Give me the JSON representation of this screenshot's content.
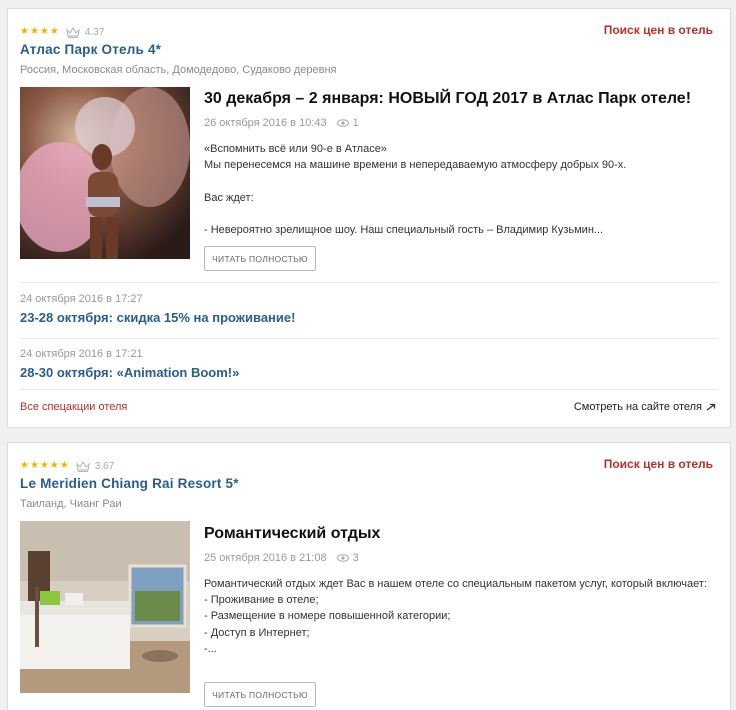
{
  "hotels": [
    {
      "stars": 4,
      "rating": "4.37",
      "price_link": "Поиск цен в отель",
      "name": "Атлас Парк Отель 4*",
      "location": "Россия, Московская область, Домодедово, Судаково деревня",
      "post": {
        "title": "30 декабря – 2 января: НОВЫЙ ГОД 2017 в Атлас Парк отеле!",
        "date": "26 октября 2016 в 10:43",
        "views": "1",
        "text": "«Вспомнить всё или 90-е в Атласе»\nМы перенесемся на машине времени в непередаваемую атмосферу добрых 90-х.\n\nВас ждет:\n\n- Невероятно зрелищное шоу. Наш специальный гость – Владимир Кузьмин...",
        "read_more": "ЧИТАТЬ ПОЛНОСТЬЮ"
      },
      "more_posts": [
        {
          "date": "24 октября 2016 в 17:27",
          "title": "23-28 октября: скидка 15% на проживание!"
        },
        {
          "date": "24 октября 2016 в 17:21",
          "title": "28-30 октября: «Animation Boom!»"
        }
      ],
      "all_offers": "Все спецакции отеля",
      "site_link": "Смотреть на сайте отеля"
    },
    {
      "stars": 5,
      "rating": "3.67",
      "price_link": "Поиск цен в отель",
      "name": "Le Meridien Chiang Rai Resort 5*",
      "location": "Таиланд, Чианг Раи",
      "post": {
        "title": "Романтический отдых",
        "date": "25 октября 2016 в 21:08",
        "views": "3",
        "text": "Романтический отдых ждет Вас в нашем отеле со специальным пакетом услуг, который включает:\n- Проживание в отеле;\n- Размещение в номере повышенной категории;\n- Доступ в Интернет;\n-...",
        "read_more": "ЧИТАТЬ ПОЛНОСТЬЮ"
      }
    }
  ],
  "colors": {
    "link_blue": "#2a5d8f",
    "accent_red": "#b3322c",
    "star_gold": "#f2b400"
  },
  "icons": [
    "star-icon",
    "crown-icon",
    "eye-icon",
    "arrow-right-icon"
  ]
}
